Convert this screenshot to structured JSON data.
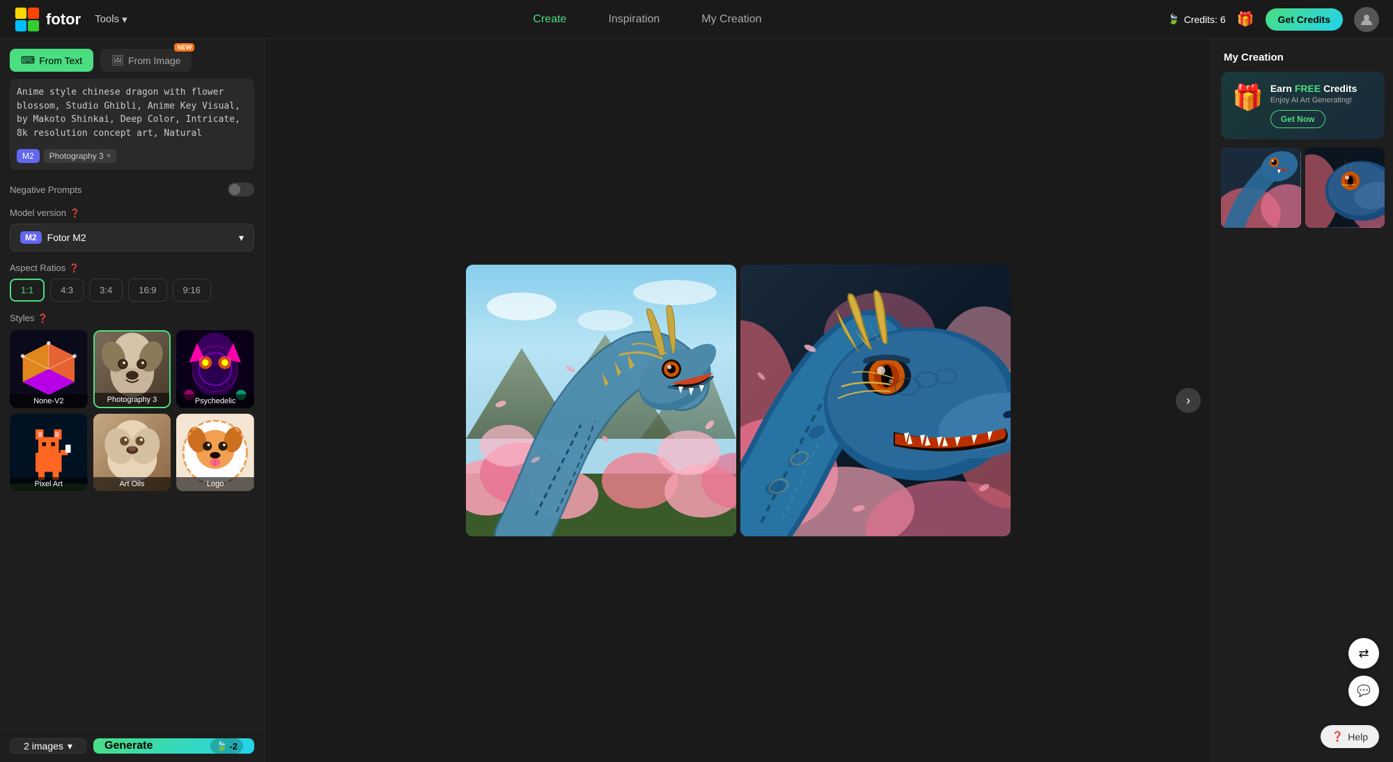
{
  "header": {
    "logo_text": "fotor",
    "tools_label": "Tools",
    "nav": {
      "create": "Create",
      "inspiration": "Inspiration",
      "my_creation": "My Creation"
    },
    "credits_label": "Credits: 6",
    "get_credits_label": "Get Credits"
  },
  "sidebar": {
    "from_text_label": "From Text",
    "from_image_label": "From Image",
    "from_image_badge": "NEW",
    "prompt_text": "Anime style chinese dragon with flower blossom, Studio Ghibli, Anime Key Visual, by Makoto Shinkai, Deep Color, Intricate, 8k resolution concept art, Natural Lighting, Beautiful",
    "tags": {
      "m2": "M2",
      "style": "Photography 3",
      "close": "×"
    },
    "negative_prompts_label": "Negative Prompts",
    "model_version_label": "Model version",
    "model_selected": "Fotor M2",
    "model_badge": "M2",
    "aspect_ratios_label": "Aspect Ratios",
    "ratios": [
      "1:1",
      "4:3",
      "3:4",
      "16:9",
      "9:16"
    ],
    "selected_ratio": "1:1",
    "styles_label": "Styles",
    "styles": [
      {
        "id": "none-v2",
        "label": "None-V2",
        "selected": false
      },
      {
        "id": "photography3",
        "label": "Photography 3",
        "selected": true
      },
      {
        "id": "psychedelic",
        "label": "Psychedelic",
        "selected": false
      },
      {
        "id": "pixel-art",
        "label": "Pixel Art",
        "selected": false
      },
      {
        "id": "art-oils",
        "label": "Art Oils",
        "selected": false
      },
      {
        "id": "logo",
        "label": "Logo",
        "selected": false
      }
    ]
  },
  "footer": {
    "images_count": "2 images",
    "generate_label": "Generate",
    "generate_cost": "-2",
    "leaf_icon": "🍃"
  },
  "right_panel": {
    "title": "My Creation",
    "earn_title_prefix": "Earn ",
    "earn_free": "FREE",
    "earn_title_suffix": " Credits",
    "earn_subtitle": "Enjoy AI Art Generating!",
    "get_now_label": "Get Now"
  },
  "floats": {
    "translate_icon": "⇄",
    "chat_icon": "💬",
    "help_label": "Help"
  }
}
